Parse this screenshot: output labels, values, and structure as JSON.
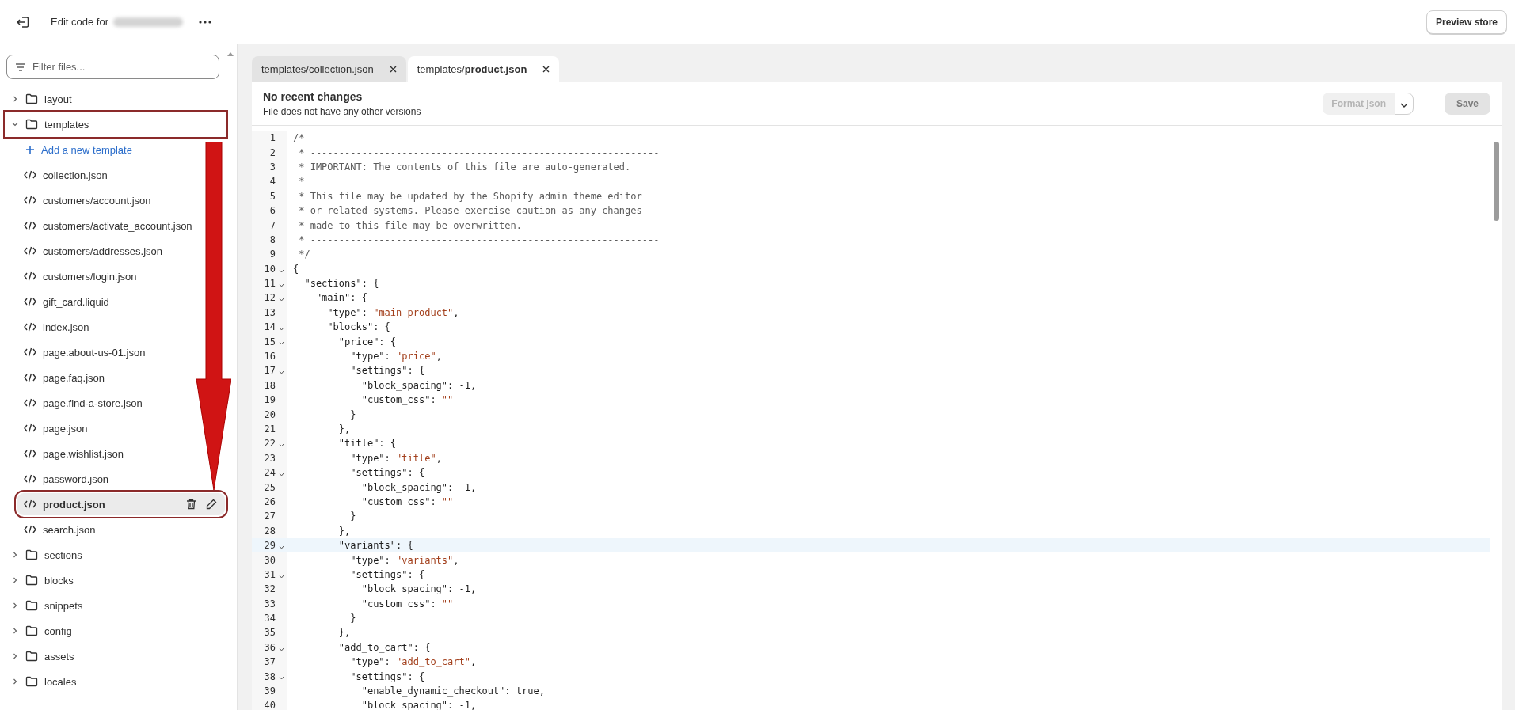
{
  "top_bar": {
    "title": "Edit code for",
    "preview_button": "Preview store"
  },
  "sidebar": {
    "filter": {
      "placeholder": "Filter files..."
    },
    "tree": [
      {
        "kind": "folder",
        "name": "layout",
        "expanded": false,
        "highlighted": false
      },
      {
        "kind": "folder",
        "name": "templates",
        "expanded": true,
        "highlighted": true,
        "children": [
          {
            "kind": "add",
            "name": "Add a new template"
          },
          {
            "kind": "file",
            "name": "collection.json",
            "selected": false,
            "highlighted": false
          },
          {
            "kind": "file",
            "name": "customers/account.json",
            "selected": false,
            "highlighted": false
          },
          {
            "kind": "file",
            "name": "customers/activate_account.json",
            "selected": false,
            "highlighted": false
          },
          {
            "kind": "file",
            "name": "customers/addresses.json",
            "selected": false,
            "highlighted": false
          },
          {
            "kind": "file",
            "name": "customers/login.json",
            "selected": false,
            "highlighted": false
          },
          {
            "kind": "file",
            "name": "gift_card.liquid",
            "selected": false,
            "highlighted": false
          },
          {
            "kind": "file",
            "name": "index.json",
            "selected": false,
            "highlighted": false
          },
          {
            "kind": "file",
            "name": "page.about-us-01.json",
            "selected": false,
            "highlighted": false
          },
          {
            "kind": "file",
            "name": "page.faq.json",
            "selected": false,
            "highlighted": false
          },
          {
            "kind": "file",
            "name": "page.find-a-store.json",
            "selected": false,
            "highlighted": false
          },
          {
            "kind": "file",
            "name": "page.json",
            "selected": false,
            "highlighted": false
          },
          {
            "kind": "file",
            "name": "page.wishlist.json",
            "selected": false,
            "highlighted": false
          },
          {
            "kind": "file",
            "name": "password.json",
            "selected": false,
            "highlighted": false
          },
          {
            "kind": "file",
            "name": "product.json",
            "selected": true,
            "highlighted": true
          },
          {
            "kind": "file",
            "name": "search.json",
            "selected": false,
            "highlighted": false
          }
        ]
      },
      {
        "kind": "folder",
        "name": "sections",
        "expanded": false,
        "highlighted": false
      },
      {
        "kind": "folder",
        "name": "blocks",
        "expanded": false,
        "highlighted": false
      },
      {
        "kind": "folder",
        "name": "snippets",
        "expanded": false,
        "highlighted": false
      },
      {
        "kind": "folder",
        "name": "config",
        "expanded": false,
        "highlighted": false
      },
      {
        "kind": "folder",
        "name": "assets",
        "expanded": false,
        "highlighted": false
      },
      {
        "kind": "folder",
        "name": "locales",
        "expanded": false,
        "highlighted": false
      }
    ]
  },
  "editor": {
    "tabs": [
      {
        "label": "templates/collection.json",
        "selected": false
      },
      {
        "label": "templates/**product.json**",
        "selected": true
      }
    ],
    "status_title": "No recent changes",
    "status_subtitle": "File does not have any other versions",
    "format_button": {
      "label": "Format json",
      "disabled": true
    },
    "save_button": {
      "label": "Save",
      "disabled": true
    },
    "lines": [
      {
        "n": "1",
        "text": "/*",
        "kind": "comment",
        "foldable": false,
        "current": false
      },
      {
        "n": "2",
        "text": " * -------------------------------------------------------------",
        "kind": "comment",
        "foldable": false,
        "current": false
      },
      {
        "n": "3",
        "text": " * IMPORTANT: The contents of this file are auto-generated.",
        "kind": "comment",
        "foldable": false,
        "current": false
      },
      {
        "n": "4",
        "text": " *",
        "kind": "comment",
        "foldable": false,
        "current": false
      },
      {
        "n": "5",
        "text": " * This file may be updated by the Shopify admin theme editor",
        "kind": "comment",
        "foldable": false,
        "current": false
      },
      {
        "n": "6",
        "text": " * or related systems. Please exercise caution as any changes",
        "kind": "comment",
        "foldable": false,
        "current": false
      },
      {
        "n": "7",
        "text": " * made to this file may be overwritten.",
        "kind": "comment",
        "foldable": false,
        "current": false
      },
      {
        "n": "8",
        "text": " * -------------------------------------------------------------",
        "kind": "comment",
        "foldable": false,
        "current": false
      },
      {
        "n": "9",
        "text": " */",
        "kind": "comment",
        "foldable": false,
        "current": false
      },
      {
        "n": "10",
        "text": "{",
        "kind": "code",
        "foldable": true,
        "current": false
      },
      {
        "n": "11",
        "text": "  \"sections\": {",
        "kind": "code",
        "foldable": true,
        "current": false
      },
      {
        "n": "12",
        "text": "    \"main\": {",
        "kind": "code",
        "foldable": true,
        "current": false
      },
      {
        "n": "13",
        "text": "      \"type\": \"main-product\",",
        "kind": "code",
        "foldable": false,
        "current": false
      },
      {
        "n": "14",
        "text": "      \"blocks\": {",
        "kind": "code",
        "foldable": true,
        "current": false
      },
      {
        "n": "15",
        "text": "        \"price\": {",
        "kind": "code",
        "foldable": true,
        "current": false
      },
      {
        "n": "16",
        "text": "          \"type\": \"price\",",
        "kind": "code",
        "foldable": false,
        "current": false
      },
      {
        "n": "17",
        "text": "          \"settings\": {",
        "kind": "code",
        "foldable": true,
        "current": false
      },
      {
        "n": "18",
        "text": "            \"block_spacing\": -1,",
        "kind": "code",
        "foldable": false,
        "current": false
      },
      {
        "n": "19",
        "text": "            \"custom_css\": \"\"",
        "kind": "code",
        "foldable": false,
        "current": false
      },
      {
        "n": "20",
        "text": "          }",
        "kind": "code",
        "foldable": false,
        "current": false
      },
      {
        "n": "21",
        "text": "        },",
        "kind": "code",
        "foldable": false,
        "current": false
      },
      {
        "n": "22",
        "text": "        \"title\": {",
        "kind": "code",
        "foldable": true,
        "current": false
      },
      {
        "n": "23",
        "text": "          \"type\": \"title\",",
        "kind": "code",
        "foldable": false,
        "current": false
      },
      {
        "n": "24",
        "text": "          \"settings\": {",
        "kind": "code",
        "foldable": true,
        "current": false
      },
      {
        "n": "25",
        "text": "            \"block_spacing\": -1,",
        "kind": "code",
        "foldable": false,
        "current": false
      },
      {
        "n": "26",
        "text": "            \"custom_css\": \"\"",
        "kind": "code",
        "foldable": false,
        "current": false
      },
      {
        "n": "27",
        "text": "          }",
        "kind": "code",
        "foldable": false,
        "current": false
      },
      {
        "n": "28",
        "text": "        },",
        "kind": "code",
        "foldable": false,
        "current": false
      },
      {
        "n": "29",
        "text": "        \"variants\": {",
        "kind": "code",
        "foldable": true,
        "current": true
      },
      {
        "n": "30",
        "text": "          \"type\": \"variants\",",
        "kind": "code",
        "foldable": false,
        "current": false
      },
      {
        "n": "31",
        "text": "          \"settings\": {",
        "kind": "code",
        "foldable": true,
        "current": false
      },
      {
        "n": "32",
        "text": "            \"block_spacing\": -1,",
        "kind": "code",
        "foldable": false,
        "current": false
      },
      {
        "n": "33",
        "text": "            \"custom_css\": \"\"",
        "kind": "code",
        "foldable": false,
        "current": false
      },
      {
        "n": "34",
        "text": "          }",
        "kind": "code",
        "foldable": false,
        "current": false
      },
      {
        "n": "35",
        "text": "        },",
        "kind": "code",
        "foldable": false,
        "current": false
      },
      {
        "n": "36",
        "text": "        \"add_to_cart\": {",
        "kind": "code",
        "foldable": true,
        "current": false
      },
      {
        "n": "37",
        "text": "          \"type\": \"add_to_cart\",",
        "kind": "code",
        "foldable": false,
        "current": false
      },
      {
        "n": "38",
        "text": "          \"settings\": {",
        "kind": "code",
        "foldable": true,
        "current": false
      },
      {
        "n": "39",
        "text": "            \"enable_dynamic_checkout\": true,",
        "kind": "code",
        "foldable": false,
        "current": false
      },
      {
        "n": "40",
        "text": "            \"block_spacing\": -1,",
        "kind": "code",
        "foldable": false,
        "current": false
      }
    ]
  }
}
